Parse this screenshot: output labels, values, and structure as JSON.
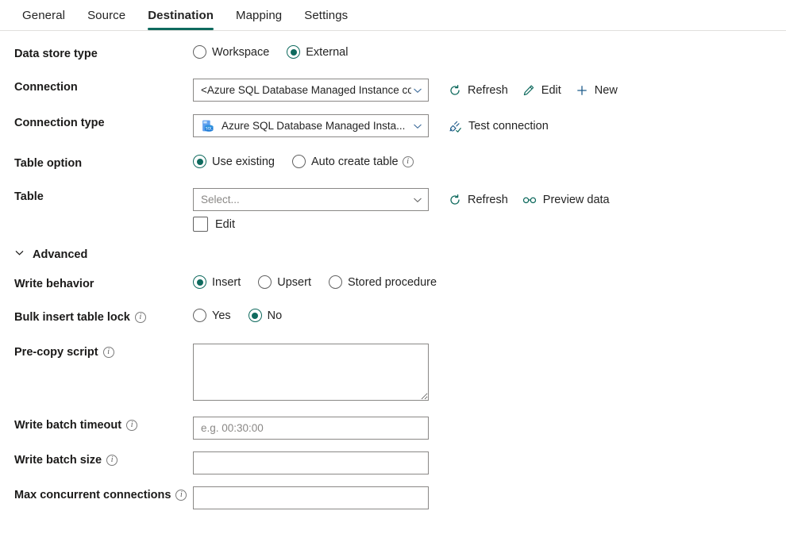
{
  "tabs": [
    {
      "label": "General",
      "active": false
    },
    {
      "label": "Source",
      "active": false
    },
    {
      "label": "Destination",
      "active": true
    },
    {
      "label": "Mapping",
      "active": false
    },
    {
      "label": "Settings",
      "active": false
    }
  ],
  "accent_color": "#0f6a5e",
  "form": {
    "data_store_type": {
      "label": "Data store type",
      "options": [
        {
          "label": "Workspace",
          "selected": false
        },
        {
          "label": "External",
          "selected": true
        }
      ]
    },
    "connection": {
      "label": "Connection",
      "value": "<Azure SQL Database Managed Instance connection>",
      "commands": [
        {
          "label": "Refresh",
          "icon": "refresh-icon"
        },
        {
          "label": "Edit",
          "icon": "pencil-icon"
        },
        {
          "label": "New",
          "icon": "plus-icon"
        }
      ]
    },
    "connection_type": {
      "label": "Connection type",
      "value": "Azure SQL Database Managed Insta...",
      "icon": "azure-sql-database-icon",
      "commands": [
        {
          "label": "Test connection",
          "icon": "test-connection-icon"
        }
      ]
    },
    "table_option": {
      "label": "Table option",
      "options": [
        {
          "label": "Use existing",
          "selected": true,
          "info": false
        },
        {
          "label": "Auto create table",
          "selected": false,
          "info": true
        }
      ]
    },
    "table": {
      "label": "Table",
      "placeholder": "Select...",
      "value": "",
      "edit_checkbox_label": "Edit",
      "edit_checked": false,
      "commands": [
        {
          "label": "Refresh",
          "icon": "refresh-icon"
        },
        {
          "label": "Preview data",
          "icon": "preview-data-icon"
        }
      ]
    },
    "advanced": {
      "label": "Advanced",
      "expanded": true
    },
    "write_behavior": {
      "label": "Write behavior",
      "options": [
        {
          "label": "Insert",
          "selected": true
        },
        {
          "label": "Upsert",
          "selected": false
        },
        {
          "label": "Stored procedure",
          "selected": false
        }
      ]
    },
    "bulk_insert_table_lock": {
      "label": "Bulk insert table lock",
      "info": true,
      "options": [
        {
          "label": "Yes",
          "selected": false
        },
        {
          "label": "No",
          "selected": true
        }
      ]
    },
    "pre_copy_script": {
      "label": "Pre-copy script",
      "info": true,
      "value": "",
      "placeholder": ""
    },
    "write_batch_timeout": {
      "label": "Write batch timeout",
      "info": true,
      "value": "",
      "placeholder": "e.g. 00:30:00"
    },
    "write_batch_size": {
      "label": "Write batch size",
      "info": true,
      "value": "",
      "placeholder": ""
    },
    "max_concurrent_connections": {
      "label": "Max concurrent connections",
      "info": true,
      "value": "",
      "placeholder": ""
    }
  }
}
